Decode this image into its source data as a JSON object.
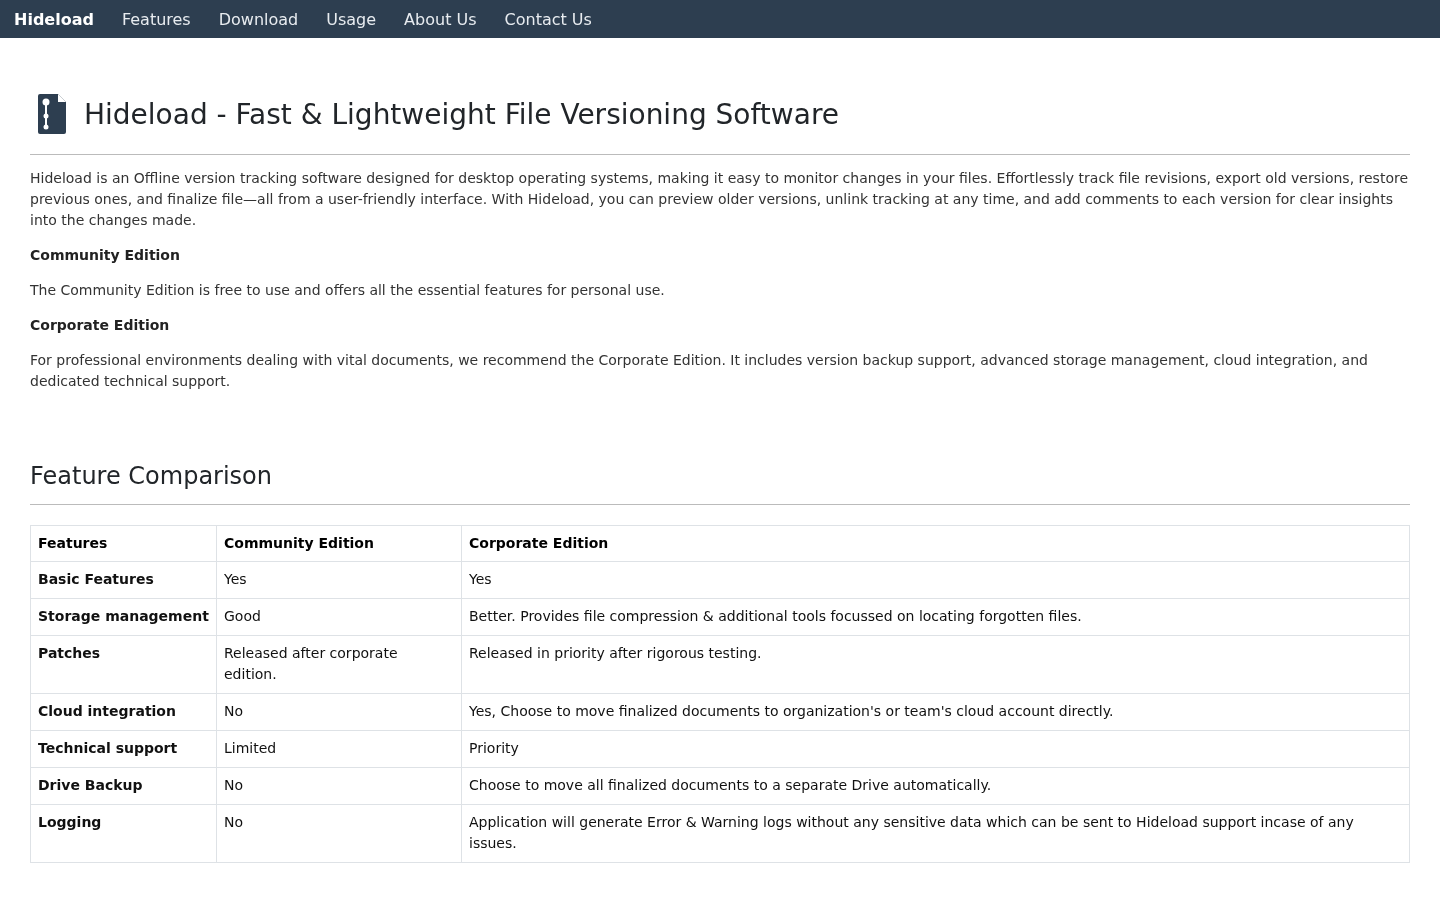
{
  "nav": {
    "brand": "Hideload",
    "links": [
      "Features",
      "Download",
      "Usage",
      "About Us",
      "Contact Us"
    ]
  },
  "title": "Hideload - Fast & Lightweight File Versioning Software",
  "intro": "Hideload is an Offline version tracking software designed for desktop operating systems, making it easy to monitor changes in your files. Effortlessly track file revisions, export old versions, restore previous ones, and finalize file—all from a user-friendly interface. With Hideload, you can preview older versions, unlink tracking at any time, and add comments to each version for clear insights into the changes made.",
  "editions": [
    {
      "heading": "Community Edition",
      "text": "The Community Edition is free to use and offers all the essential features for personal use."
    },
    {
      "heading": "Corporate Edition",
      "text": "For professional environments dealing with vital documents, we recommend the Corporate Edition. It includes version backup support, advanced storage management, cloud integration, and dedicated technical support."
    }
  ],
  "comparison": {
    "heading": "Feature Comparison",
    "columns": [
      "Features",
      "Community Edition",
      "Corporate Edition"
    ],
    "rows": [
      [
        "Basic Features",
        "Yes",
        "Yes"
      ],
      [
        "Storage management",
        "Good",
        "Better. Provides file compression & additional tools focussed on locating forgotten files."
      ],
      [
        "Patches",
        "Released after corporate edition.",
        "Released in priority after rigorous testing."
      ],
      [
        "Cloud integration",
        "No",
        "Yes, Choose to move finalized documents to organization's or team's cloud account directly."
      ],
      [
        "Technical support",
        "Limited",
        "Priority"
      ],
      [
        "Drive Backup",
        "No",
        "Choose to move all finalized documents to a separate Drive automatically."
      ],
      [
        "Logging",
        "No",
        "Application will generate Error & Warning logs without any sensitive data which can be sent to Hideload support incase of any issues."
      ]
    ]
  }
}
